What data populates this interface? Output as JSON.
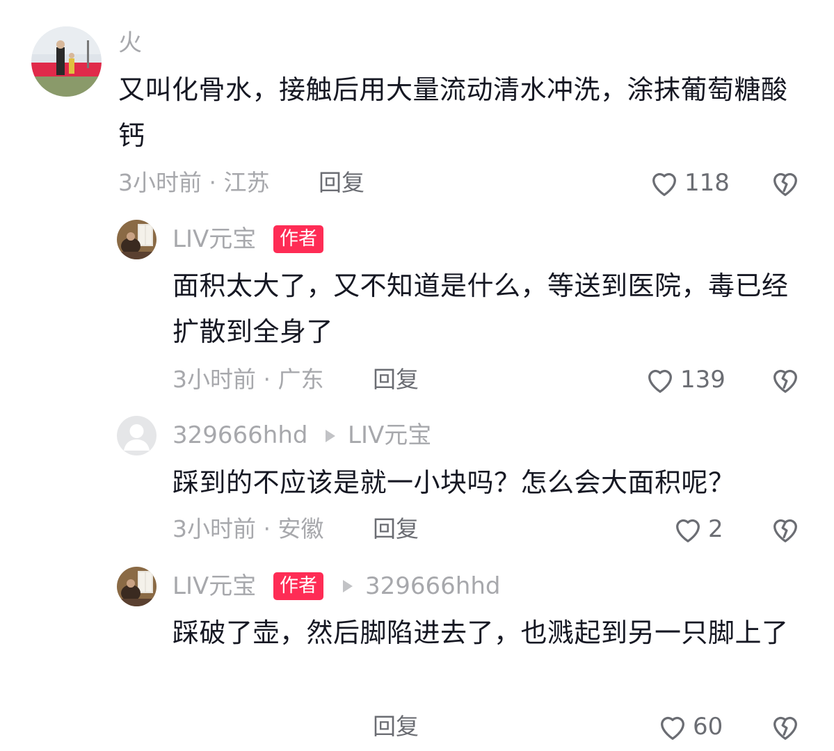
{
  "comments": [
    {
      "username": "火",
      "text": "又叫化骨水，接触后用大量流动清水冲洗，涂抹葡萄糖酸钙",
      "meta": "3小时前 · 江苏",
      "reply_label": "回复",
      "like_count": "118"
    },
    {
      "username": "LIV元宝",
      "badge": "作者",
      "text": "面积太大了，又不知道是什么，等送到医院，毒已经扩散到全身了",
      "meta": "3小时前 · 广东",
      "reply_label": "回复",
      "like_count": "139"
    },
    {
      "username": "329666hhd",
      "reply_to": "LIV元宝",
      "text": "踩到的不应该是就一小块吗？怎么会大面积呢？",
      "meta": "3小时前 · 安徽",
      "reply_label": "回复",
      "like_count": "2"
    },
    {
      "username": "LIV元宝",
      "badge": "作者",
      "reply_to": "329666hhd",
      "text": "踩破了壶，然后脚陷进去了，也溅起到另一只脚上了",
      "reply_label": "回复",
      "like_count": "60"
    }
  ],
  "icons": {
    "like": "heart-outline-icon",
    "dislike": "broken-heart-icon",
    "reply_arrow": "triangle-right-icon"
  },
  "colors": {
    "badge": "#fe2c55",
    "muted": "#a7a8ac",
    "text": "#161823"
  }
}
